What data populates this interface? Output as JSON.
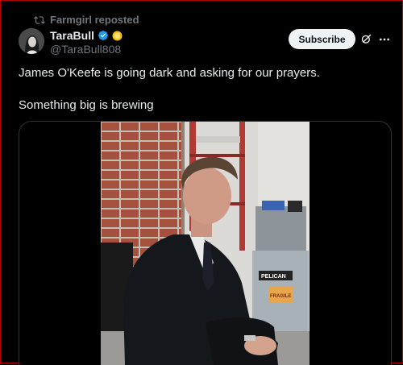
{
  "repost": {
    "text": "Farmgirl reposted",
    "icon": "repost-icon"
  },
  "author": {
    "display_name": "TaraBull",
    "handle": "@TaraBull808",
    "verified_color": "#1d9bf0",
    "badge_color": "#f4c21a"
  },
  "actions": {
    "subscribe_label": "Subscribe",
    "grok_icon": "grok-icon",
    "more_icon": "more-icon"
  },
  "tweet": {
    "line1": "James O'Keefe is going dark and asking for our prayers.",
    "line2": "Something big is brewing"
  },
  "media": {
    "type": "video",
    "case_label": "PELICAN",
    "sticker_label": "FRAGILE"
  }
}
